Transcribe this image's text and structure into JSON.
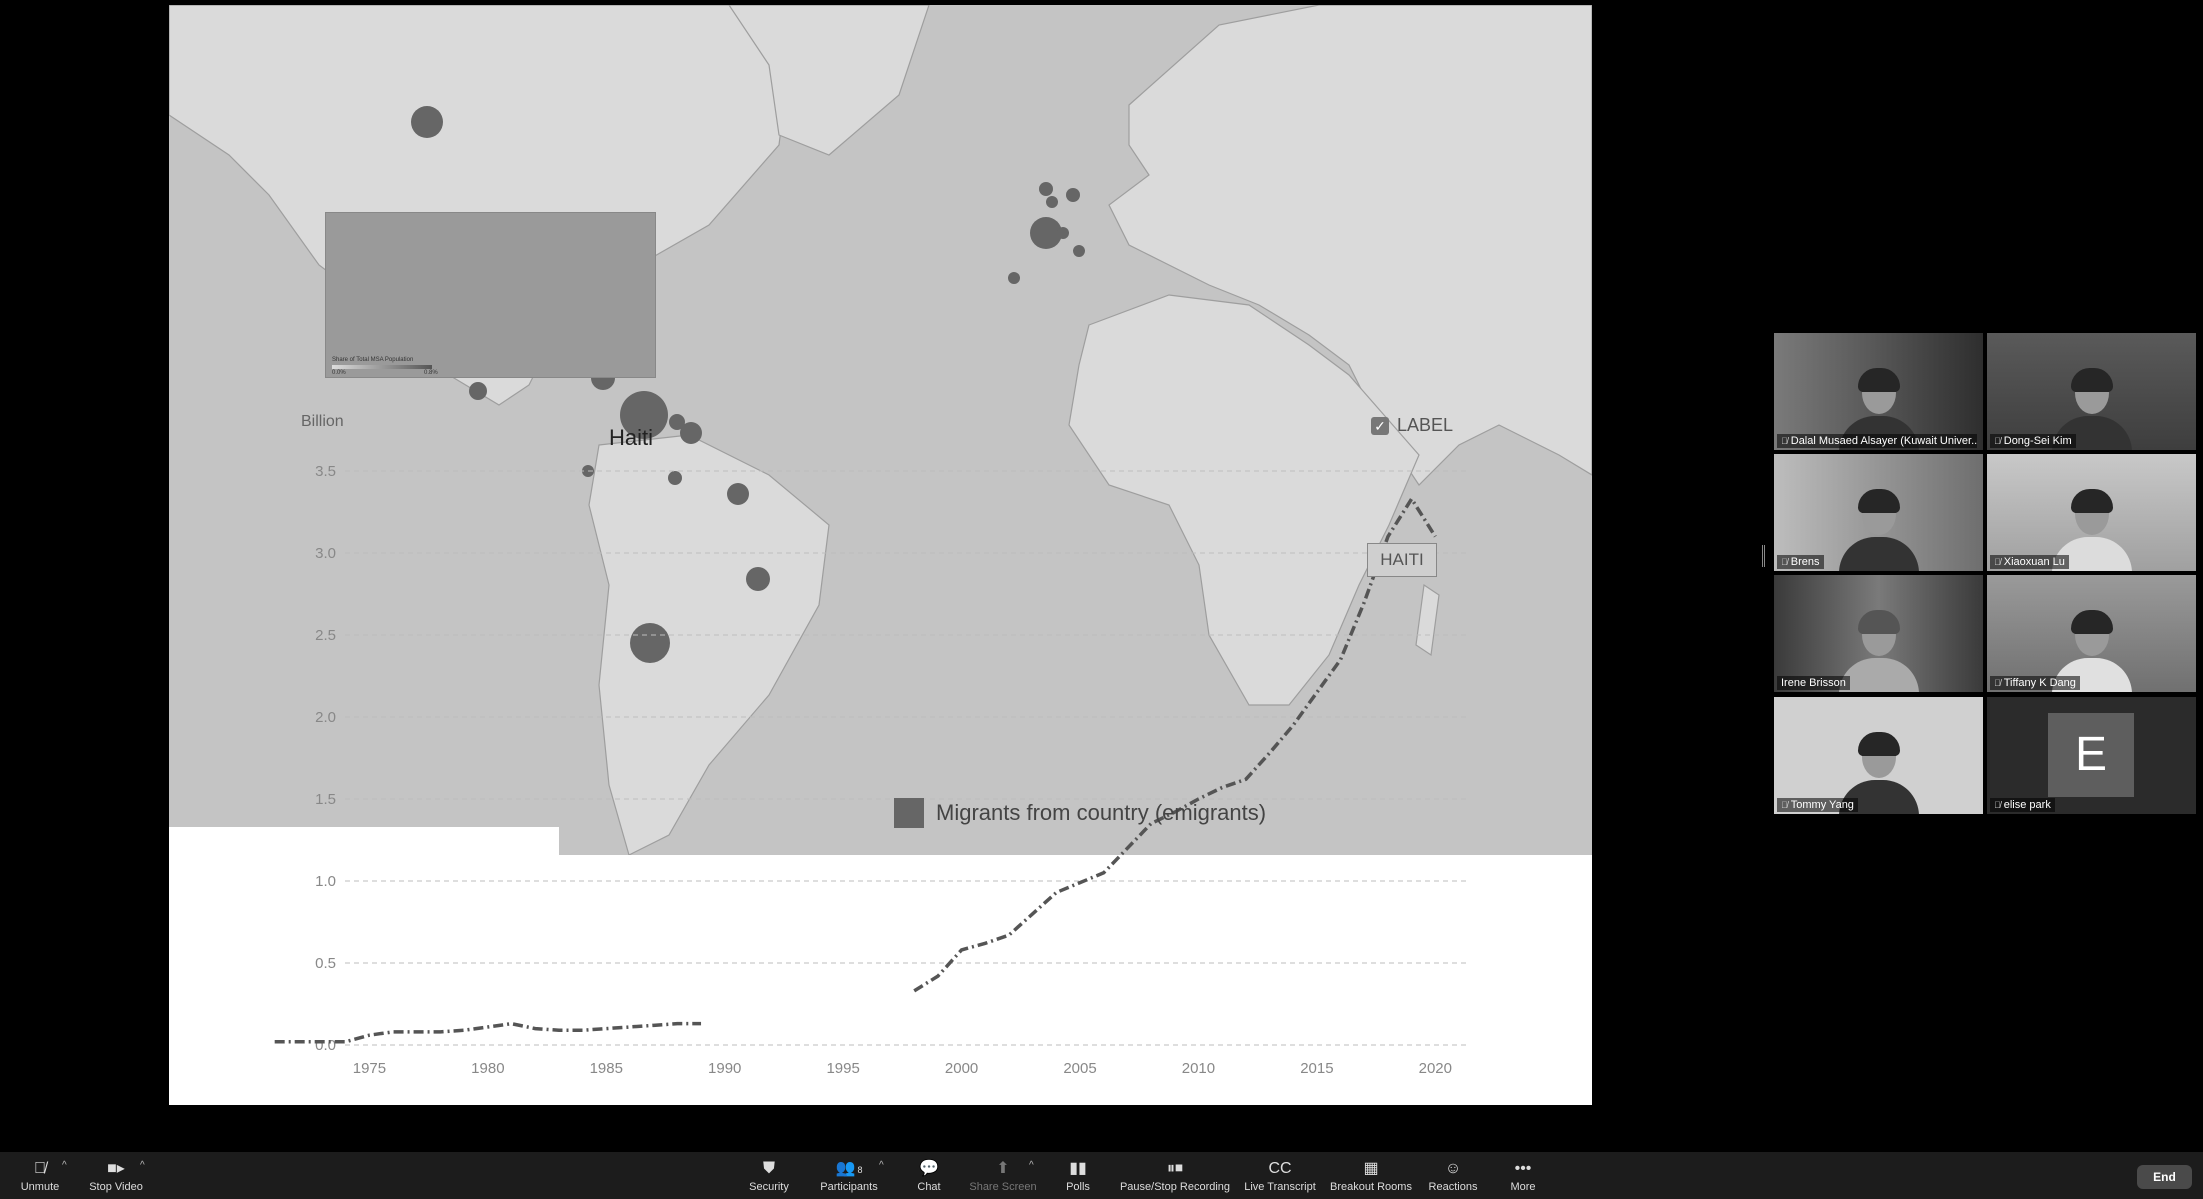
{
  "map": {
    "inset_caption": "Share of Total MSA Population",
    "inset_min": "0.0%",
    "inset_max": "0.8%",
    "highlight_label": "Haiti"
  },
  "chart_controls": {
    "label_toggle_text": "LABEL",
    "label_toggle_checked": true,
    "series_tag": "HAITI"
  },
  "legend": {
    "text": "Migrants from country (emigrants)"
  },
  "chart_data": {
    "type": "line",
    "ylabel": "Billion",
    "xlim": [
      1970,
      2021
    ],
    "ylim": [
      0,
      3.5
    ],
    "yticks": [
      "0.0",
      "0.5",
      "1.0",
      "1.5",
      "2.0",
      "2.5",
      "3.0",
      "3.5"
    ],
    "xticks": [
      "1975",
      "1980",
      "1985",
      "1990",
      "1995",
      "2000",
      "2005",
      "2010",
      "2015",
      "2020"
    ],
    "grid": true,
    "legend_position": "bottom",
    "series": [
      {
        "name": "Migrants from country (emigrants)",
        "segments": [
          {
            "x": [
              1971,
              1972,
              1973,
              1974,
              1975,
              1976,
              1977,
              1978,
              1979,
              1980,
              1981,
              1982,
              1983,
              1984,
              1985,
              1986,
              1987,
              1988,
              1989
            ],
            "y": [
              0.02,
              0.02,
              0.02,
              0.02,
              0.06,
              0.08,
              0.08,
              0.08,
              0.09,
              0.11,
              0.13,
              0.1,
              0.09,
              0.09,
              0.1,
              0.11,
              0.12,
              0.13,
              0.13
            ]
          },
          {
            "x": [
              1998,
              1999,
              2000,
              2001,
              2002,
              2003,
              2004,
              2005,
              2006,
              2007,
              2008,
              2009,
              2010,
              2011,
              2012,
              2013,
              2014,
              2015,
              2016,
              2017,
              2018,
              2019,
              2020
            ],
            "y": [
              0.33,
              0.42,
              0.58,
              0.62,
              0.67,
              0.8,
              0.93,
              0.99,
              1.05,
              1.2,
              1.35,
              1.42,
              1.5,
              1.57,
              1.62,
              1.78,
              1.95,
              2.15,
              2.35,
              2.7,
              3.1,
              3.33,
              3.1
            ]
          }
        ]
      }
    ]
  },
  "participants": [
    {
      "name": "Dalal Musaed Alsayer (Kuwait Univer...",
      "muted": true,
      "active": false,
      "initial": ""
    },
    {
      "name": "Dong-Sei Kim",
      "muted": true,
      "active": false,
      "initial": ""
    },
    {
      "name": "Brens",
      "muted": true,
      "active": false,
      "initial": ""
    },
    {
      "name": "Xiaoxuan Lu",
      "muted": true,
      "active": false,
      "initial": ""
    },
    {
      "name": "Irene Brisson",
      "muted": false,
      "active": true,
      "initial": ""
    },
    {
      "name": "Tiffany K Dang",
      "muted": true,
      "active": false,
      "initial": ""
    },
    {
      "name": "Tommy Yang",
      "muted": true,
      "active": false,
      "initial": ""
    },
    {
      "name": "elise park",
      "muted": true,
      "active": false,
      "initial": "E"
    }
  ],
  "toolbar": {
    "unmute": "Unmute",
    "stop_video": "Stop Video",
    "security": "Security",
    "participants": "Participants",
    "participants_count": "8",
    "chat": "Chat",
    "share_screen": "Share Screen",
    "polls": "Polls",
    "pause_stop_recording": "Pause/Stop Recording",
    "live_transcript": "Live Transcript",
    "breakout_rooms": "Breakout Rooms",
    "reactions": "Reactions",
    "more": "More",
    "end": "End"
  },
  "colors": {
    "map_water": "#c4c4c4",
    "map_land": "#dadada",
    "bubble": "#666666",
    "series": "#555555",
    "toolbar_bg": "#1c1c1c"
  }
}
